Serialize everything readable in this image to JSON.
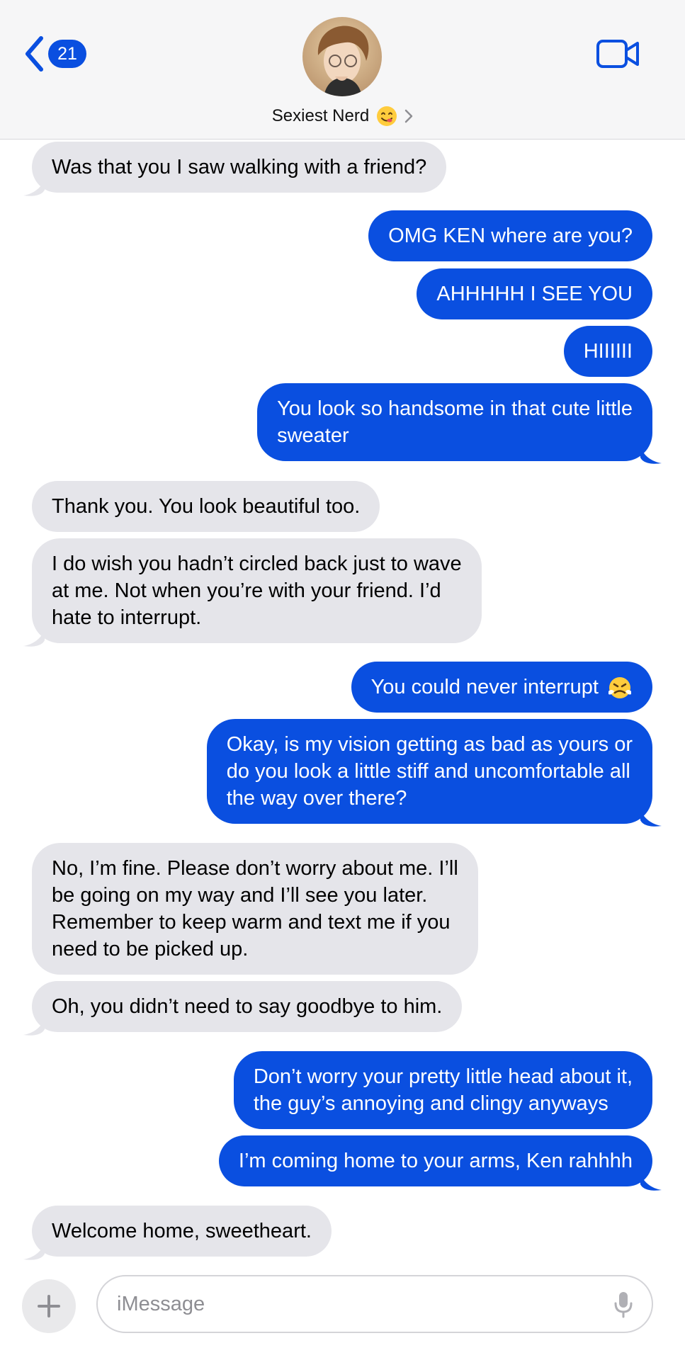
{
  "header": {
    "back_count": "21",
    "contact_name": "Sexiest Nerd",
    "contact_emoji": "yum-face-emoji",
    "video_icon": "video-camera-icon"
  },
  "messages": [
    {
      "side": "in",
      "text": "Was that you I saw walking with a friend?"
    },
    {
      "side": "out",
      "text": "OMG KEN where are you?"
    },
    {
      "side": "out",
      "text": "AHHHHH I SEE YOU"
    },
    {
      "side": "out",
      "text": "HIIIIII"
    },
    {
      "side": "out",
      "lines": [
        "You look so handsome in that cute little",
        "sweater"
      ]
    },
    {
      "side": "in",
      "text": "Thank you. You look beautiful too."
    },
    {
      "side": "in",
      "lines": [
        "I do wish you hadn’t circled back just to wave",
        "at me. Not when you’re with your friend. I’d",
        "hate to interrupt."
      ]
    },
    {
      "side": "out",
      "text": "You could never interrupt",
      "emoji": "face-with-steam-emoji"
    },
    {
      "side": "out",
      "lines": [
        "Okay, is my vision getting as bad as yours or",
        "do you look a little stiff and uncomfortable all",
        "the way over there?"
      ]
    },
    {
      "side": "in",
      "lines": [
        "No, I’m fine. Please don’t worry about me. I’ll",
        "be going on my way and I’ll see you later.",
        "Remember to keep warm and text me if you",
        "need to be picked up."
      ]
    },
    {
      "side": "in",
      "text": "Oh, you didn’t need to say goodbye to him."
    },
    {
      "side": "out",
      "lines": [
        "Don’t worry your pretty little head about it,",
        "the guy’s annoying and clingy anyways"
      ]
    },
    {
      "side": "out",
      "text": "I’m coming home to your arms, Ken rahhhh"
    },
    {
      "side": "in",
      "text": "Welcome home, sweetheart."
    }
  ],
  "composer": {
    "placeholder": "iMessage",
    "add_icon": "plus-icon",
    "mic_icon": "microphone-icon"
  },
  "colors": {
    "outgoing": "#0a4fe0",
    "incoming": "#e5e5ea"
  }
}
